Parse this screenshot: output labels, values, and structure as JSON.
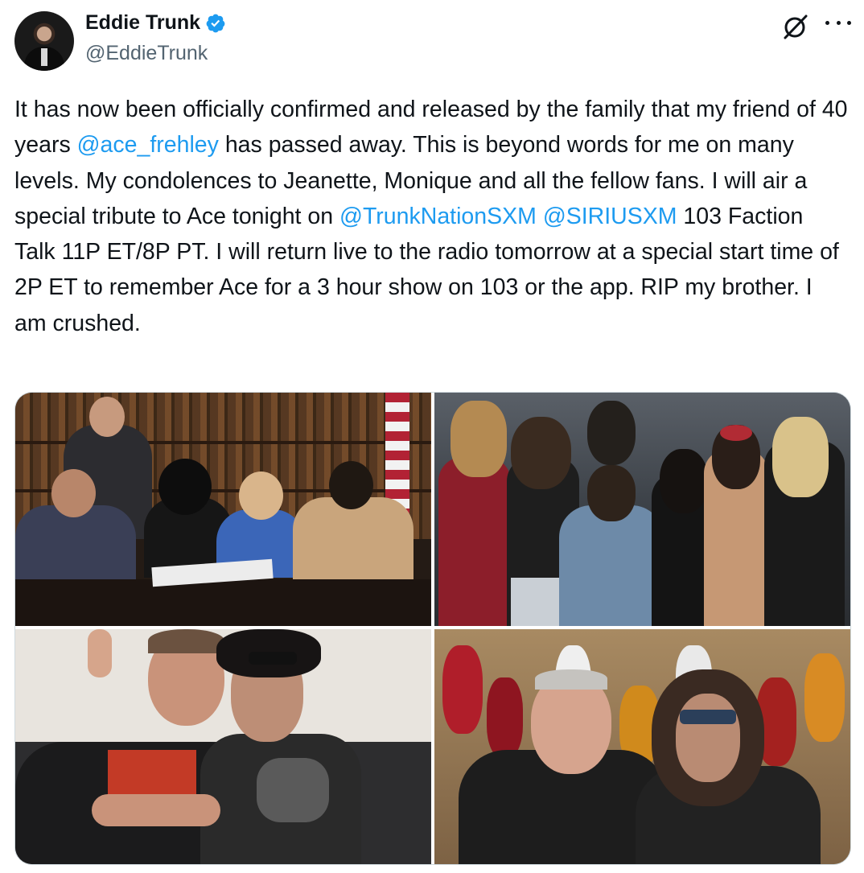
{
  "author": {
    "display_name": "Eddie Trunk",
    "handle": "@EddieTrunk",
    "verified": true
  },
  "icons": {
    "grok": "grok-icon",
    "more": "more-options-icon",
    "verified": "verified-badge-icon"
  },
  "tweet": {
    "segments": [
      {
        "text": "It has now been officially confirmed and released by the family that my friend of 40 years ",
        "mention": false
      },
      {
        "text": "@ace_frehley",
        "mention": true
      },
      {
        "text": " has passed away. This is beyond words for me on many levels. My condolences to Jeanette, Monique and all the fellow fans. I will air a special tribute to Ace tonight on ",
        "mention": false
      },
      {
        "text": "@TrunkNationSXM",
        "mention": true
      },
      {
        "text": " ",
        "mention": false
      },
      {
        "text": "@SIRIUSXM",
        "mention": true
      },
      {
        "text": " 103 Faction Talk 11P ET/8P PT. I will return live to the radio tomorrow at a special start time of 2P ET to remember Ace for a 3 hour show on 103 or the app. RIP my brother. I am crushed.",
        "mention": false
      }
    ]
  },
  "media": {
    "count": 4,
    "photos": [
      "photo-1",
      "photo-2",
      "photo-3",
      "photo-4"
    ]
  },
  "colors": {
    "link": "#1d9bf0",
    "text": "#0f1419",
    "secondary": "#536471",
    "border": "#cfd9de"
  }
}
